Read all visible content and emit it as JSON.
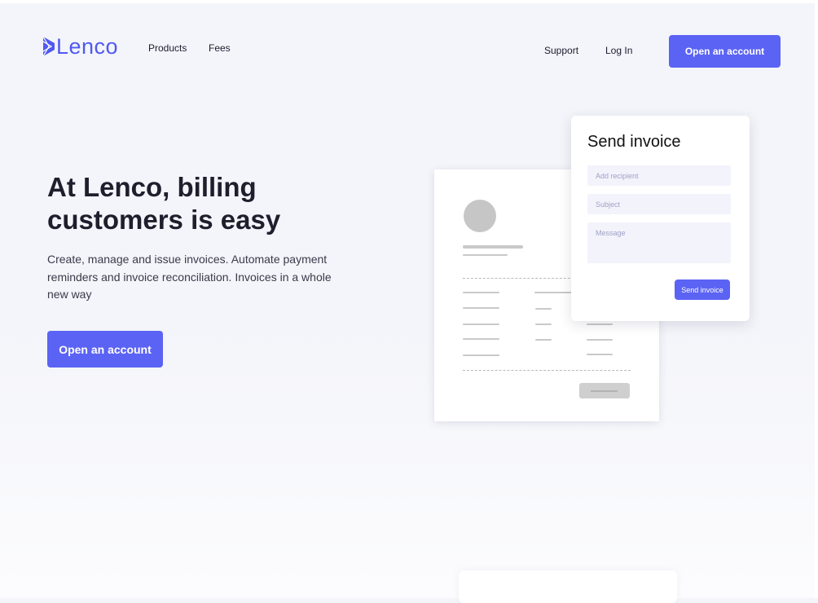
{
  "nav": {
    "brand": "Lenco",
    "links": [
      "Products",
      "Fees"
    ],
    "support": "Support",
    "login": "Log In",
    "cta": "Open an account"
  },
  "hero": {
    "title": "At Lenco, billing customers is easy",
    "description": "Create, manage and issue invoices. Automate payment reminders and invoice reconciliation. Invoices in a whole new way",
    "cta": "Open an account"
  },
  "send_invoice": {
    "title": "Send invoice",
    "recipient_placeholder": "Add recipient",
    "subject_placeholder": "Subject",
    "message_placeholder": "Message",
    "button": "Send invoice"
  },
  "colors": {
    "brand": "#5059f0",
    "button": "#5b63f4",
    "background": "#f4f5fa"
  }
}
